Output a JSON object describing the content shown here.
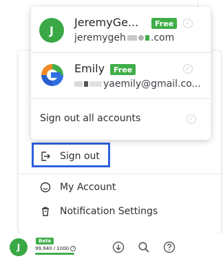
{
  "accounts": [
    {
      "avatar_initial": "J",
      "name": "JeremyGe...",
      "badge": "Free",
      "email": "jeremygeh",
      "email_tail": ".com",
      "active": true
    },
    {
      "name": "Emily",
      "badge": "Free",
      "email": "yaemily@gmail.co...",
      "active": false
    }
  ],
  "account_menu": {
    "sign_out_all": "Sign out all accounts"
  },
  "menu": {
    "sign_out": "Sign out",
    "my_account": "My Account",
    "notification_settings": "Notification Settings"
  },
  "bottom_bar": {
    "avatar_initial": "J",
    "beta_badge": "Beta",
    "quota_text": "99,940 / 1000",
    "quota_fraction": 1.0
  },
  "colors": {
    "brand_green": "#3fae49",
    "avatar_green": "#39a845",
    "highlight_blue": "#2f5fe0"
  },
  "icons": {
    "sign_out": "sign-out-icon",
    "my_account": "smiley-icon",
    "notification_settings": "trash-icon",
    "download": "download-icon",
    "search": "search-icon",
    "help": "help-icon"
  }
}
